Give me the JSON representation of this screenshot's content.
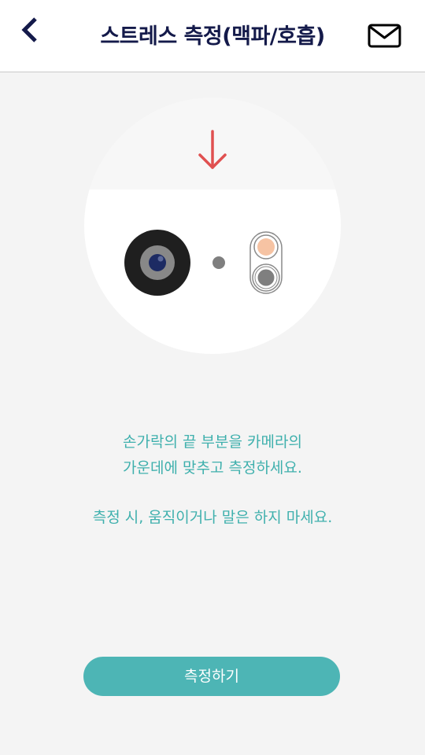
{
  "header": {
    "title": "스트레스 측정(맥파/호흡)",
    "back_icon": "chevron-left-icon",
    "mail_icon": "envelope-icon"
  },
  "illustration": {
    "arrow_icon": "arrow-down-icon",
    "lens_icon": "camera-lens-icon",
    "flash_icon": "camera-flash-icon"
  },
  "instructions": {
    "line1": "손가락의 끝 부분을 카메라의",
    "line2": "가운데에 맞추고 측정하세요.",
    "line3": "측정 시, 움직이거나 말은 하지 마세요."
  },
  "actions": {
    "measure_label": "측정하기"
  },
  "colors": {
    "title": "#141a4a",
    "accent_text": "#3fb0ad",
    "button": "#4db5b5",
    "arrow": "#e05050",
    "flash": "#f6c3a3"
  }
}
